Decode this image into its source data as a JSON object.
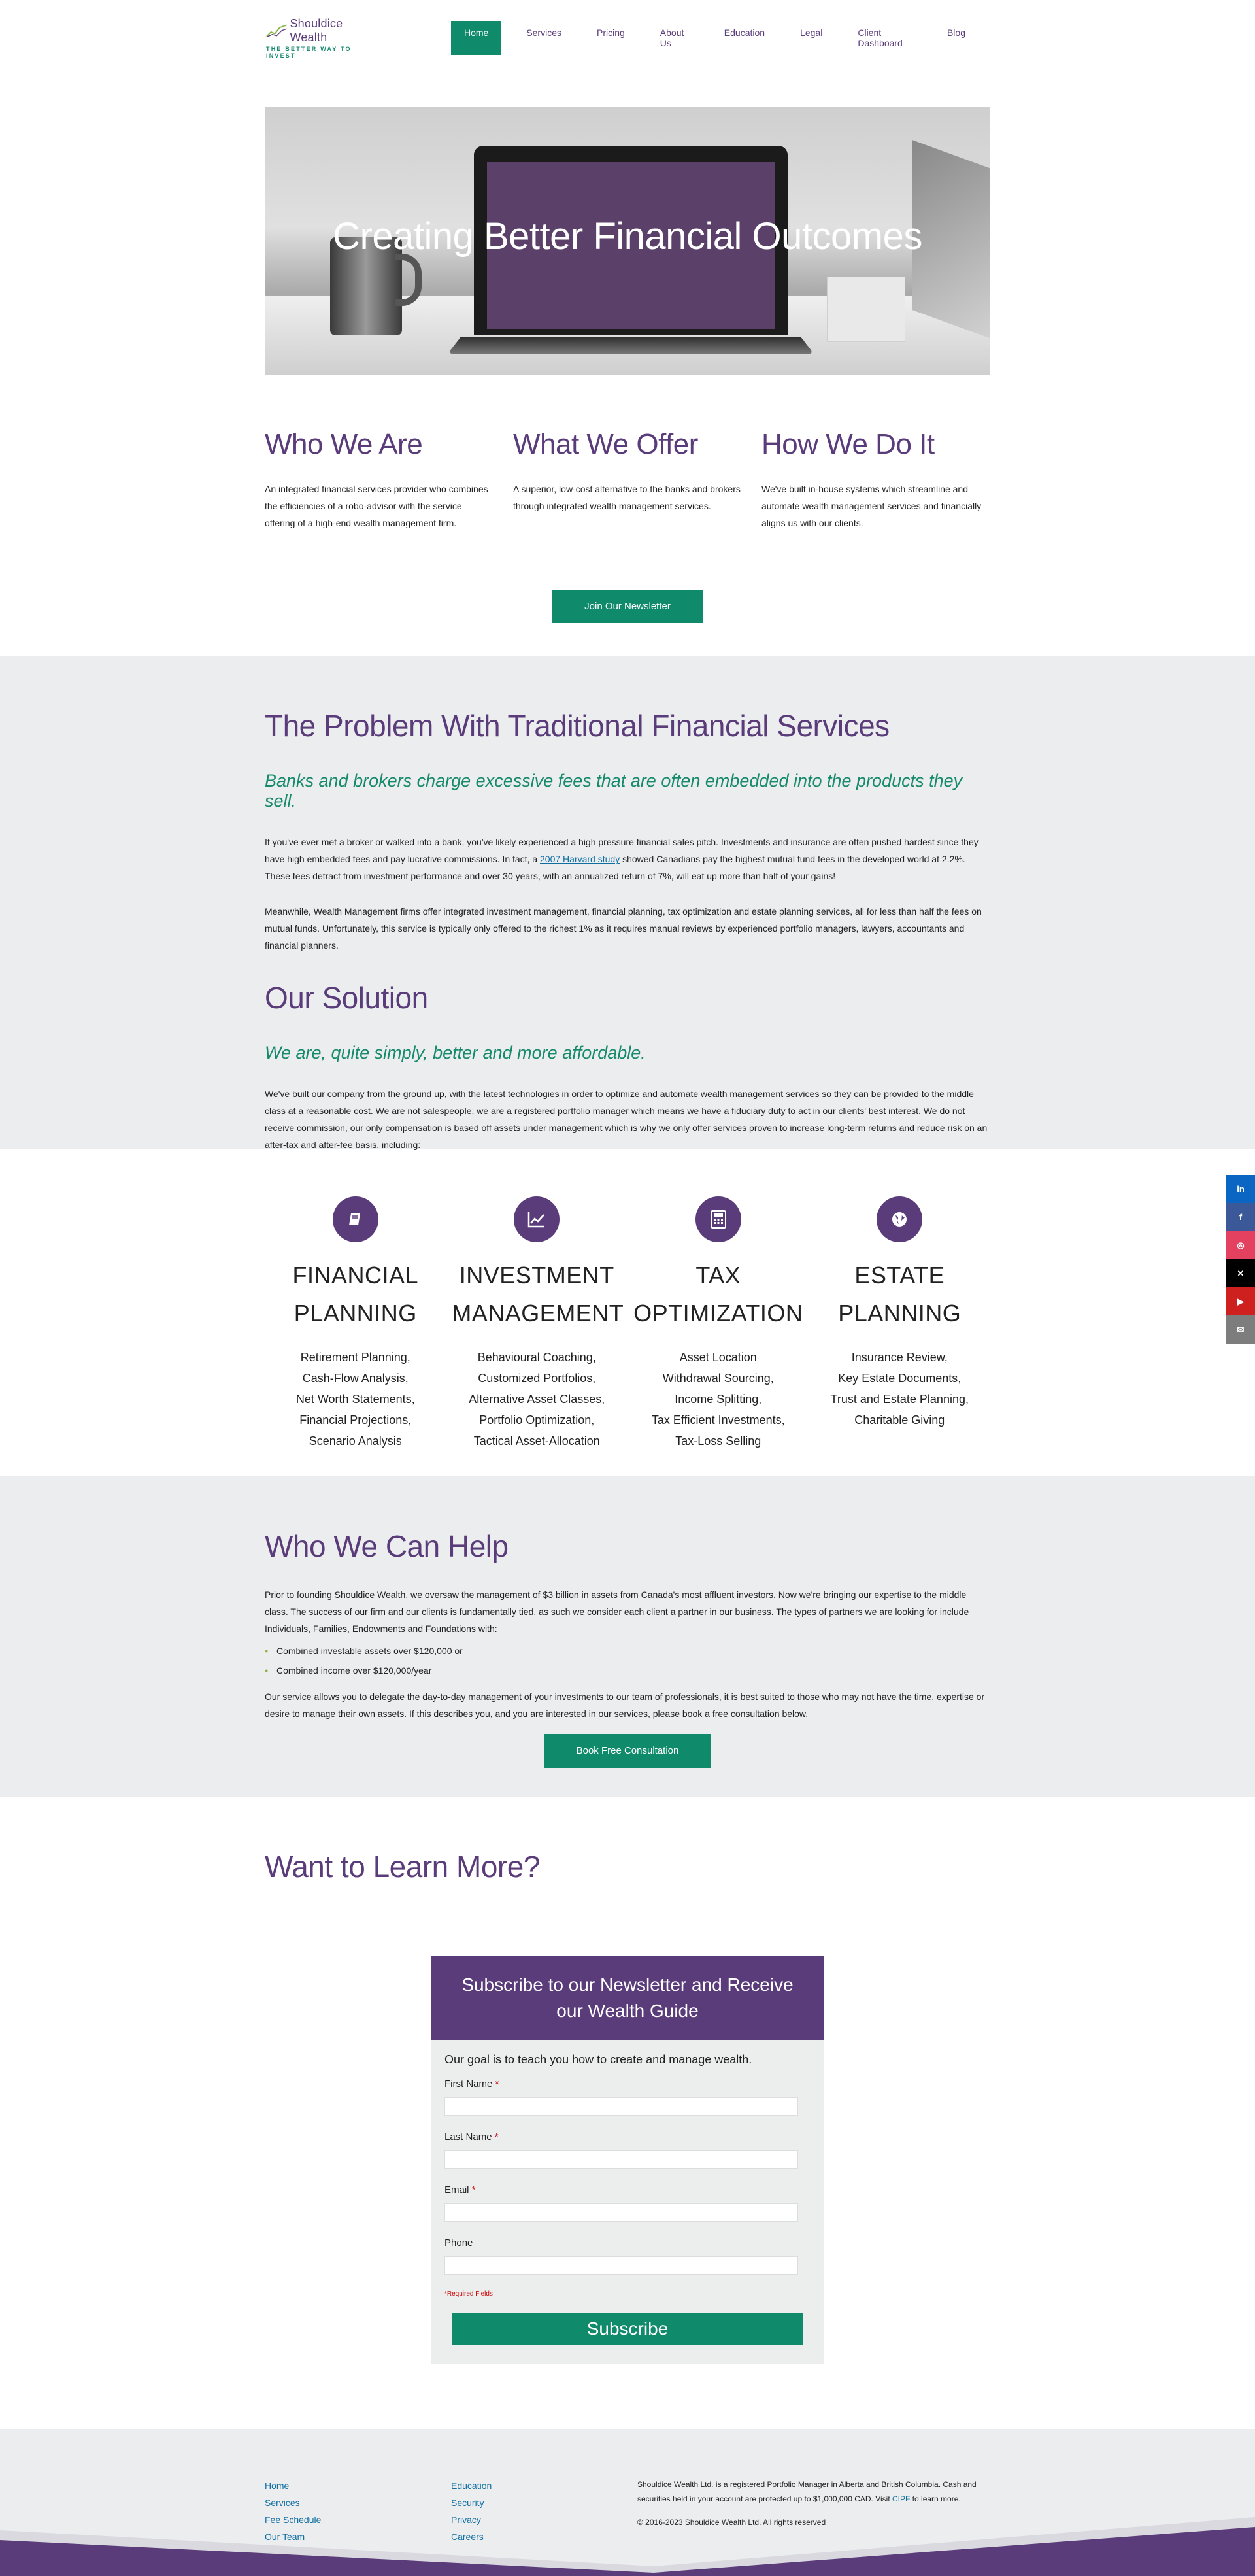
{
  "logo": {
    "name": "Shouldice Wealth",
    "tagline": "THE BETTER WAY TO INVEST"
  },
  "nav": [
    {
      "label": "Home",
      "active": true
    },
    {
      "label": "Services"
    },
    {
      "label": "Pricing"
    },
    {
      "label": "About Us"
    },
    {
      "label": "Education"
    },
    {
      "label": "Legal"
    },
    {
      "label": "Client Dashboard"
    },
    {
      "label": "Blog"
    }
  ],
  "hero": {
    "title": "Creating Better Financial Outcomes"
  },
  "intro": [
    {
      "title": "Who We Are",
      "text": "An integrated financial services provider who combines the efficiencies of a robo-advisor with the service offering of a high-end wealth management firm."
    },
    {
      "title": "What We Offer",
      "text": "A superior, low-cost alternative to the banks and brokers through integrated wealth management services."
    },
    {
      "title": "How We Do It",
      "text": "We've built in-house systems which streamline and automate wealth management services and financially aligns us with our clients."
    }
  ],
  "newsletter_button": "Join Our Newsletter",
  "problem": {
    "title": "The Problem With Traditional Financial Services",
    "subtitle": "Banks and brokers charge excessive fees that are often embedded into the products they sell.",
    "p1_before": "If you've ever met a broker or walked into a bank, you've likely experienced a high pressure financial sales pitch. Investments and insurance are often pushed hardest since they have high embedded fees and pay lucrative commissions. In fact, a ",
    "p1_link": "2007 Harvard study",
    "p1_after": " showed Canadians pay the highest mutual fund fees in the developed world at 2.2%. These fees detract from investment performance and over 30 years, with an annualized return of 7%, will eat up more than half of your gains!",
    "p2": "Meanwhile, Wealth Management firms offer integrated investment management, financial planning, tax optimization and estate planning services, all for less than half the fees on mutual funds. Unfortunately, this service is typically only offered to the richest 1% as it requires manual reviews by experienced portfolio managers, lawyers, accountants and financial planners.",
    "solution_title": "Our Solution",
    "solution_subtitle": "We are, quite simply, better and more affordable.",
    "solution_text": "We've built our company from the ground up, with the latest technologies in order to optimize and automate wealth management services so they can be provided to the middle class at a reasonable cost. We are not salespeople, we are a registered portfolio manager which means we have a fiduciary duty to act in our clients' best interest. We do not receive commission, our only compensation is based off assets under management which is why we only offer services proven to increase long-term returns and reduce risk on an after-tax and after-fee basis, including:"
  },
  "services": [
    {
      "icon": "book-icon",
      "title_l1": "FINANCIAL",
      "title_l2": "PLANNING",
      "items": [
        "Retirement Planning,",
        "Cash-Flow Analysis,",
        "Net Worth Statements,",
        "Financial Projections,",
        "Scenario Analysis"
      ]
    },
    {
      "icon": "chart-line-icon",
      "title_l1": "INVESTMENT",
      "title_l2": "MANAGEMENT",
      "items": [
        "Behavioural Coaching,",
        "Customized Portfolios,",
        "Alternative Asset Classes,",
        "Portfolio Optimization,",
        "Tactical Asset-Allocation"
      ]
    },
    {
      "icon": "calculator-icon",
      "title_l1": "TAX",
      "title_l2": "OPTIMIZATION",
      "items": [
        "Asset Location",
        "Withdrawal Sourcing,",
        "Income Splitting,",
        "Tax Efficient Investments,",
        "Tax-Loss Selling"
      ]
    },
    {
      "icon": "globe-icon",
      "title_l1": "ESTATE",
      "title_l2": "PLANNING",
      "items": [
        "Insurance Review,",
        "Key Estate Documents,",
        "Trust and Estate Planning,",
        "Charitable Giving"
      ]
    }
  ],
  "help": {
    "title": "Who We Can Help",
    "p1": "Prior to founding Shouldice Wealth, we oversaw the management of $3 billion in assets from Canada's most affluent investors. Now we're bringing our expertise to the middle class. The success of our firm and our clients is fundamentally tied, as such we consider each client a partner in our business. The types of partners we are looking for include Individuals, Families, Endowments and Foundations with:",
    "bullets": [
      "Combined investable assets over $120,000 or",
      "Combined income over $120,000/year"
    ],
    "p2": "Our service allows you to delegate the day-to-day management of your investments to our team of professionals, it is best suited to those who may not have the time, expertise or desire to manage their own assets. If this describes you, and you are interested in our services, please book a free consultation below.",
    "button": "Book Free Consultation"
  },
  "learn": {
    "title": "Want to Learn More?",
    "form_title": "Subscribe to our Newsletter and Receive our Wealth Guide",
    "lead": "Our goal is to teach you how to create and manage wealth.",
    "fields": [
      {
        "label": "First Name",
        "required": "*"
      },
      {
        "label": "Last Name",
        "required": "*"
      },
      {
        "label": "Email",
        "required": "*"
      },
      {
        "label": "Phone",
        "required": ""
      }
    ],
    "required_note": "*Required Fields",
    "submit": "Subscribe"
  },
  "footer": {
    "col1": [
      "Home",
      "Services",
      "Fee Schedule",
      "Our Team"
    ],
    "col2": [
      "Education",
      "Security",
      "Privacy",
      "Careers"
    ],
    "text_before": "Shouldice Wealth Ltd. is a registered Portfolio Manager in Alberta and British Columbia. Cash and securities held in your account are protected up to $1,000,000 CAD. Visit ",
    "text_link": "CIPF",
    "text_after": " to learn more.",
    "copyright": "© 2016-2023 Shouldice Wealth Ltd. All rights reserved"
  },
  "social": [
    {
      "icon": "linkedin-icon",
      "glyph": "in",
      "color": "#0a66c2"
    },
    {
      "icon": "facebook-icon",
      "glyph": "f",
      "color": "#3b5998"
    },
    {
      "icon": "instagram-icon",
      "glyph": "◎",
      "color": "#e4405f"
    },
    {
      "icon": "x-icon",
      "glyph": "✕",
      "color": "#000000"
    },
    {
      "icon": "youtube-icon",
      "glyph": "▶",
      "color": "#cd201f"
    },
    {
      "icon": "email-icon",
      "glyph": "✉",
      "color": "#7d7d7d"
    }
  ],
  "colors": {
    "purple": "#5a3c7a",
    "green": "#0f8a6b",
    "gray_bg": "#ecedee",
    "link": "#0f6fa3"
  }
}
